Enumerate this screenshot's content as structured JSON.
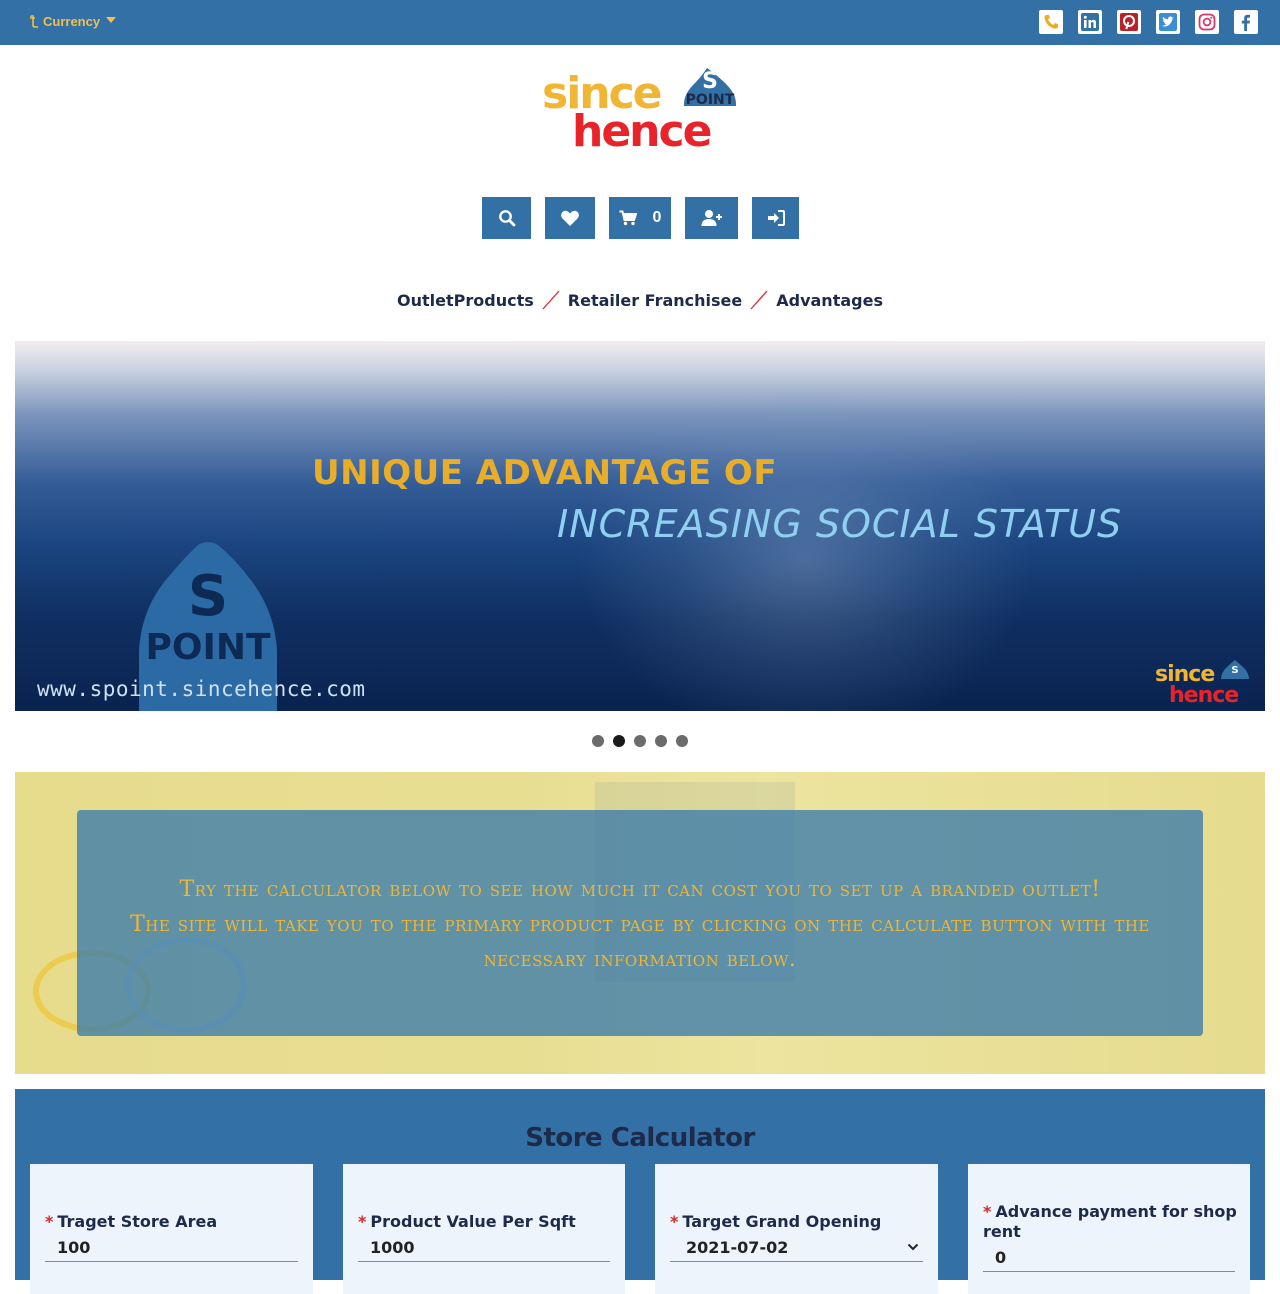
{
  "topbar": {
    "currency_label": "Currency",
    "social_icons": [
      "phone-icon",
      "linkedin-icon",
      "pinterest-icon",
      "twitter-icon",
      "instagram-icon",
      "facebook-icon"
    ]
  },
  "logo": {
    "line1": "since",
    "line2": "hence",
    "badge_letter": "S",
    "badge_word": "POINT"
  },
  "actions": {
    "cart_count": "0",
    "icons": [
      "search-icon",
      "heart-icon",
      "cart-icon",
      "user-plus-icon",
      "sign-in-icon"
    ]
  },
  "nav": {
    "items": [
      "OutletProducts",
      "Retailer Franchisee",
      "Advantages"
    ]
  },
  "banner": {
    "headline": "UNIQUE ADVANTAGE OF",
    "subheadline": "INCREASING SOCIAL STATUS",
    "url": "www.spoint.sincehence.com",
    "logo_badge_letter": "S",
    "logo_badge_word": "POINT",
    "mini_line1": "since",
    "mini_line2": "hence"
  },
  "carousel": {
    "slide_count": 5,
    "active_index": 1
  },
  "promo": {
    "line1": "Try the calculator below to see how much it can cost you to set up a branded outlet!",
    "line2": "The site will take you to the primary product page by clicking on the calculate button with the necessary information below."
  },
  "calculator": {
    "title": "Store Calculator",
    "fields": [
      {
        "label": "Traget Store Area",
        "value": "100"
      },
      {
        "label": "Product Value Per Sqft",
        "value": "1000"
      },
      {
        "label": "Target Grand Opening",
        "value": "2021-07-02"
      },
      {
        "label": "Advance payment for shop rent",
        "value": "0"
      }
    ],
    "required_mark": "*"
  },
  "colors": {
    "brand_blue": "#3370a6",
    "accent_yellow": "#f1b534",
    "logo_red": "#e8232a",
    "navy_text": "#1d2a4a"
  }
}
